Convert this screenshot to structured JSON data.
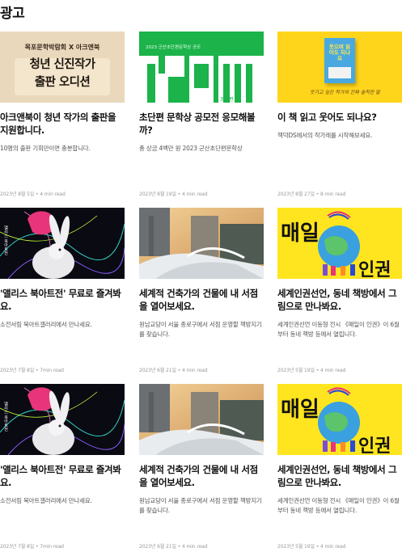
{
  "section": {
    "title": "광고"
  },
  "thumb_text": {
    "mokpo_top": "목포문학박람회 X 아크앤북",
    "mokpo_line1": "청년 신진작가",
    "mokpo_line2": "출판 오디션",
    "poster_header": "2023 군산초단편문학상 공모",
    "poster_big": "초단편",
    "book_title": "웃으며 읽어도 되나요",
    "book_hand": "웃기고 싶은 작가의 진짜 솔직한 말",
    "rabbit_side": "앨리스 북아트전",
    "human_big1": "매일",
    "human_big2": "인권"
  },
  "cards": [
    {
      "title": "아크앤북이 청년 작가의 출판을 지원합니다.",
      "desc": "10명의 출판 기회만이면 충분합니다.",
      "meta": "2023년 8월 5일 • 4 min read"
    },
    {
      "title": "초단편 문학상 공모전 응모해볼까?",
      "desc": "총 상금 4백만 원 2023 군산초단편문학상",
      "meta": "2023년 8월 19일 • 4 min read"
    },
    {
      "title": "이 책 읽고 웃어도 되나요?",
      "desc": "책덕DS에서의 작가레를 시작해보세요.",
      "meta": "2023년 8월 27일 • 8 min read"
    },
    {
      "title": "'앨리스 북아트전' 무료로 즐겨봐요.",
      "desc": "소전서림 북아트갤러리에서 만나세요.",
      "meta": "2023년 7월 8일 • 7min read"
    },
    {
      "title": "세계적 건축가의 건물에 내 서점을 열어보세요.",
      "desc": "원남교당이 서울 종로구에서 서점 운영할 책방지기를 찾습니다.",
      "meta": "2023년 6월 21일 • 4 min read"
    },
    {
      "title": "세계인권선언, 동네 책방에서 그림으로 만나봐요.",
      "desc": "세계인권선언 이동형 전시 《매일이 인권》이 6월부터 동네 책방 등에서 열립니다.",
      "meta": "2023년 5월 19일 • 4 min read"
    },
    {
      "title": "'앨리스 북아트전' 무료로 즐겨봐요.",
      "desc": "소전서림 북아트갤러리에서 만나세요.",
      "meta": "2023년 7월 8일 • 7min read"
    },
    {
      "title": "세계적 건축가의 건물에 내 서점을 열어보세요.",
      "desc": "원남교당이 서울 종로구에서 서점 운영할 책방지기를 찾습니다.",
      "meta": "2023년 6월 21일 • 4 min read"
    },
    {
      "title": "세계인권선언, 동네 책방에서 그림으로 만나봐요.",
      "desc": "세계인권선언 이동형 전시 《매일이 인권》이 6월부터 동네 책방 등에서 열립니다.",
      "meta": "2023년 5월 19일 • 4 min read"
    }
  ],
  "colors": {
    "poster_green": "#1bb34a",
    "book_yellow": "#ffd51c",
    "human_yellow": "#ffe51f",
    "rabbit_pink": "#e8347a"
  }
}
